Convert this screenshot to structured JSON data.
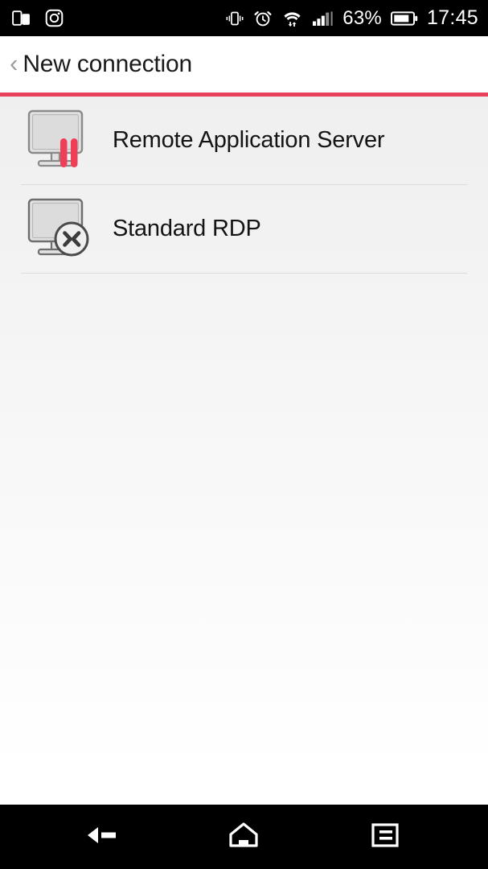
{
  "status_bar": {
    "left_icons": [
      {
        "name": "multi-window-icon"
      },
      {
        "name": "instagram-icon"
      }
    ],
    "right_icons": [
      {
        "name": "vibrate-icon"
      },
      {
        "name": "alarm-clock-icon"
      },
      {
        "name": "wifi-data-transfer-icon"
      },
      {
        "name": "cellular-signal-icon"
      }
    ],
    "battery_percent": "63%",
    "battery_icon": "battery-icon",
    "clock": "17:45"
  },
  "app_bar": {
    "back_icon": "back-chevron-icon",
    "back_glyph": "‹",
    "title": "New connection",
    "accent_color": "#e8415c"
  },
  "connection_types": {
    "items": [
      {
        "label": "Remote Application Server",
        "icon": "monitor-ras-icon"
      },
      {
        "label": "Standard RDP",
        "icon": "monitor-rdp-icon"
      }
    ]
  },
  "nav_bar": {
    "buttons": [
      {
        "name": "nav-back-button",
        "label": "Back"
      },
      {
        "name": "nav-home-button",
        "label": "Home"
      },
      {
        "name": "nav-recents-button",
        "label": "Recents"
      }
    ]
  }
}
